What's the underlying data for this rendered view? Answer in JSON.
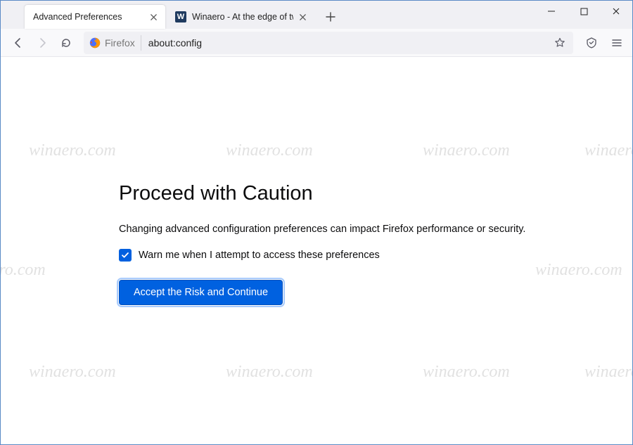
{
  "tabs": [
    {
      "title": "Advanced Preferences",
      "active": true
    },
    {
      "title": "Winaero - At the edge of tweak",
      "active": false
    }
  ],
  "urlbar": {
    "identity_label": "Firefox",
    "url": "about:config"
  },
  "content": {
    "heading": "Proceed with Caution",
    "body": "Changing advanced configuration preferences can impact Firefox performance or security.",
    "checkbox_label": "Warn me when I attempt to access these preferences",
    "checkbox_checked": true,
    "button_label": "Accept the Risk and Continue"
  },
  "watermark_text": "winaero.com"
}
